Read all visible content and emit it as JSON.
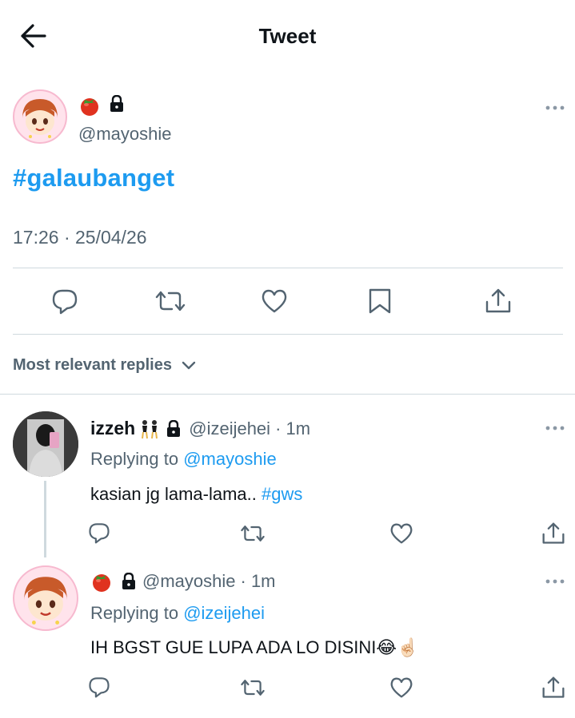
{
  "header": {
    "title": "Tweet"
  },
  "tweet": {
    "handle": "@mayoshie",
    "text": "#galaubanget",
    "timestamp": "17:26 · 25/04/26"
  },
  "actions": [
    "reply-icon",
    "retweet-icon",
    "like-icon",
    "bookmark-icon",
    "share-icon"
  ],
  "replies_sort": {
    "label": "Most relevant replies"
  },
  "replies": [
    {
      "name": "izzeh",
      "handle": "@izeijehei",
      "time": "· 1m",
      "replying_prefix": "Replying to",
      "replying_to": "@mayoshie",
      "text": "kasian jg lama-lama.. ",
      "hashtag": "#gws"
    },
    {
      "handle": "@mayoshie",
      "time": "· 1m",
      "replying_prefix": "Replying to",
      "replying_to": "@izeijehei",
      "text": "IH BGST GUE LUPA ADA LO DISINI",
      "emoji": "😂☝🏻"
    }
  ],
  "colors": {
    "link": "#1d9bf0",
    "muted": "#536471",
    "divider": "#cfd9de"
  }
}
